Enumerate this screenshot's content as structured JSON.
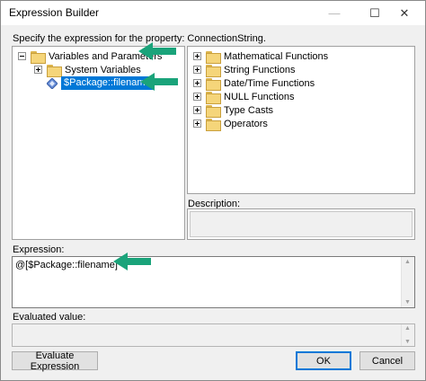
{
  "window": {
    "title": "Expression Builder",
    "minimize_glyph": "—",
    "maximize_glyph": "☐",
    "close_glyph": "✕"
  },
  "prompt": "Specify the expression for the property: ConnectionString.",
  "left_tree": {
    "root": {
      "label": "Variables and Parameters",
      "expanded": true
    },
    "system_variables": {
      "label": "System Variables",
      "expanded": false
    },
    "selected_variable": {
      "label": "$Package::filename",
      "selected": true,
      "icon": "variable-icon"
    }
  },
  "right_tree": {
    "items": [
      {
        "label": "Mathematical Functions"
      },
      {
        "label": "String Functions"
      },
      {
        "label": "Date/Time Functions"
      },
      {
        "label": "NULL Functions"
      },
      {
        "label": "Type Casts"
      },
      {
        "label": "Operators"
      }
    ]
  },
  "description": {
    "label": "Description:",
    "value": ""
  },
  "expression": {
    "label": "Expression:",
    "value": "@[$Package::filename]"
  },
  "evaluated": {
    "label": "Evaluated value:",
    "value": ""
  },
  "buttons": {
    "evaluate": "Evaluate Expression",
    "ok": "OK",
    "cancel": "Cancel"
  },
  "colors": {
    "selection": "#0078d7",
    "annotation_arrow": "#1aa37a",
    "folder": "#f5d57a"
  }
}
